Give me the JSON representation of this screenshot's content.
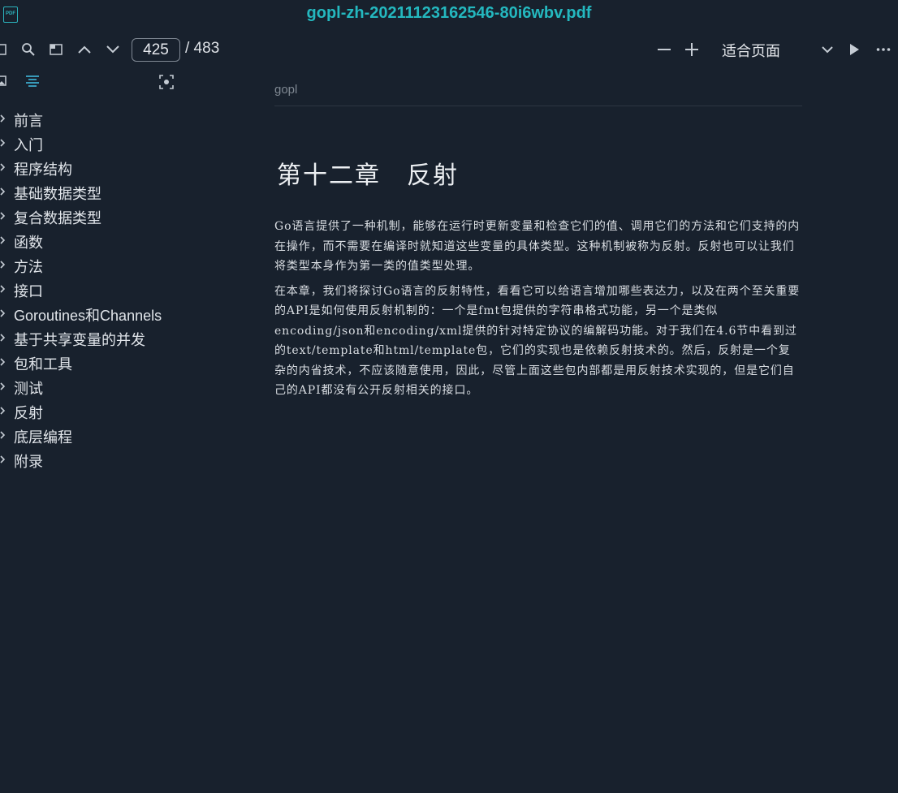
{
  "window": {
    "title": "gopl-zh-20211123162546-80i6wbv.pdf",
    "app_icon_text": "PDF",
    "accent": "#24b8bf",
    "background": "#18212d"
  },
  "toolbar": {
    "current_page": "425",
    "page_total": "/ 483",
    "zoom": "适合页面"
  },
  "outline": {
    "items": [
      {
        "label": "前言"
      },
      {
        "label": "入门"
      },
      {
        "label": "程序结构"
      },
      {
        "label": "基础数据类型"
      },
      {
        "label": "复合数据类型"
      },
      {
        "label": "函数"
      },
      {
        "label": "方法"
      },
      {
        "label": "接口"
      },
      {
        "label": "Goroutines和Channels"
      },
      {
        "label": "基于共享变量的并发"
      },
      {
        "label": "包和工具"
      },
      {
        "label": "测试"
      },
      {
        "label": "反射"
      },
      {
        "label": "底层编程"
      },
      {
        "label": "附录"
      }
    ]
  },
  "page": {
    "running_head": "gopl",
    "chapter_title": "第十二章　反射",
    "paragraphs": [
      "Go语言提供了一种机制，能够在运行时更新变量和检查它们的值、调用它们的方法和它们支持的内在操作，而不需要在编译时就知道这些变量的具体类型。这种机制被称为反射。反射也可以让我们将类型本身作为第一类的值类型处理。",
      "在本章，我们将探讨Go语言的反射特性，看看它可以给语言增加哪些表达力，以及在两个至关重要的API是如何使用反射机制的：一个是fmt包提供的字符串格式功能，另一个是类似encoding/json和encoding/xml提供的针对特定协议的编解码功能。对于我们在4.6节中看到过的text/template和html/template包，它们的实现也是依赖反射技术的。然后，反射是一个复杂的内省技术，不应该随意使用，因此，尽管上面这些包内部都是用反射技术实现的，但是它们自己的API都没有公开反射相关的接口。"
    ]
  }
}
